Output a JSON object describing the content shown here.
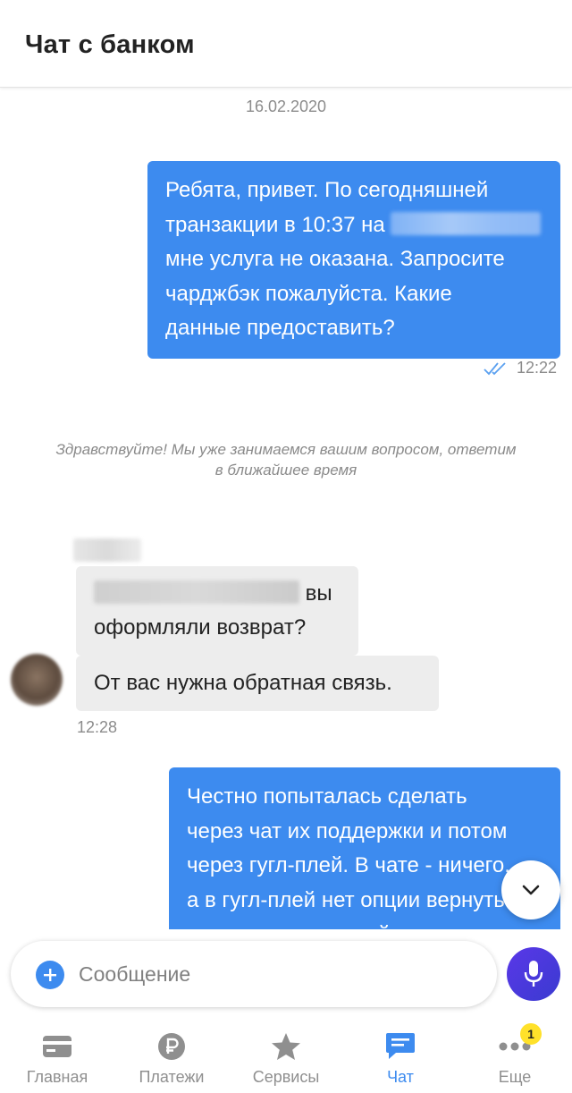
{
  "header": {
    "title": "Чат с банком"
  },
  "chat": {
    "date": "16.02.2020",
    "messages": [
      {
        "lines": [
          "Ребята, привет. По сегодняшней",
          "транзакции в 10:37 на",
          "мне услуга не оказана. Запросите",
          "чарджбэк пожалуйста. Какие",
          "данные предоставить?"
        ],
        "time": "12:22"
      },
      {
        "lines": [
          "вы",
          "оформляли возврат?"
        ]
      },
      {
        "lines": [
          "От вас нужна обратная связь."
        ],
        "time": "12:28"
      },
      {
        "lines": [
          "Честно попыталась сделать",
          "через чат их поддержки и потом",
          "через гугл-плей. В чате - ничего,",
          "а в гугл-плей нет опции вернуть",
          "заказ, совершенный внутри"
        ]
      }
    ],
    "system_message": [
      "Здравствуйте! Мы уже занимаемся вашим вопросом, ответим",
      "в ближайшее время"
    ]
  },
  "composer": {
    "placeholder": "Сообщение"
  },
  "tabs": [
    {
      "label": "Главная",
      "icon": "card-icon"
    },
    {
      "label": "Платежи",
      "icon": "ruble-icon"
    },
    {
      "label": "Сервисы",
      "icon": "star-icon"
    },
    {
      "label": "Чат",
      "icon": "chat-icon",
      "active": true
    },
    {
      "label": "Еще",
      "icon": "more-icon",
      "badge": "1"
    }
  ],
  "colors": {
    "accent": "#3d8bef",
    "mic": "#4a39dd",
    "badge": "#ffe12a",
    "incoming": "#ededed"
  }
}
